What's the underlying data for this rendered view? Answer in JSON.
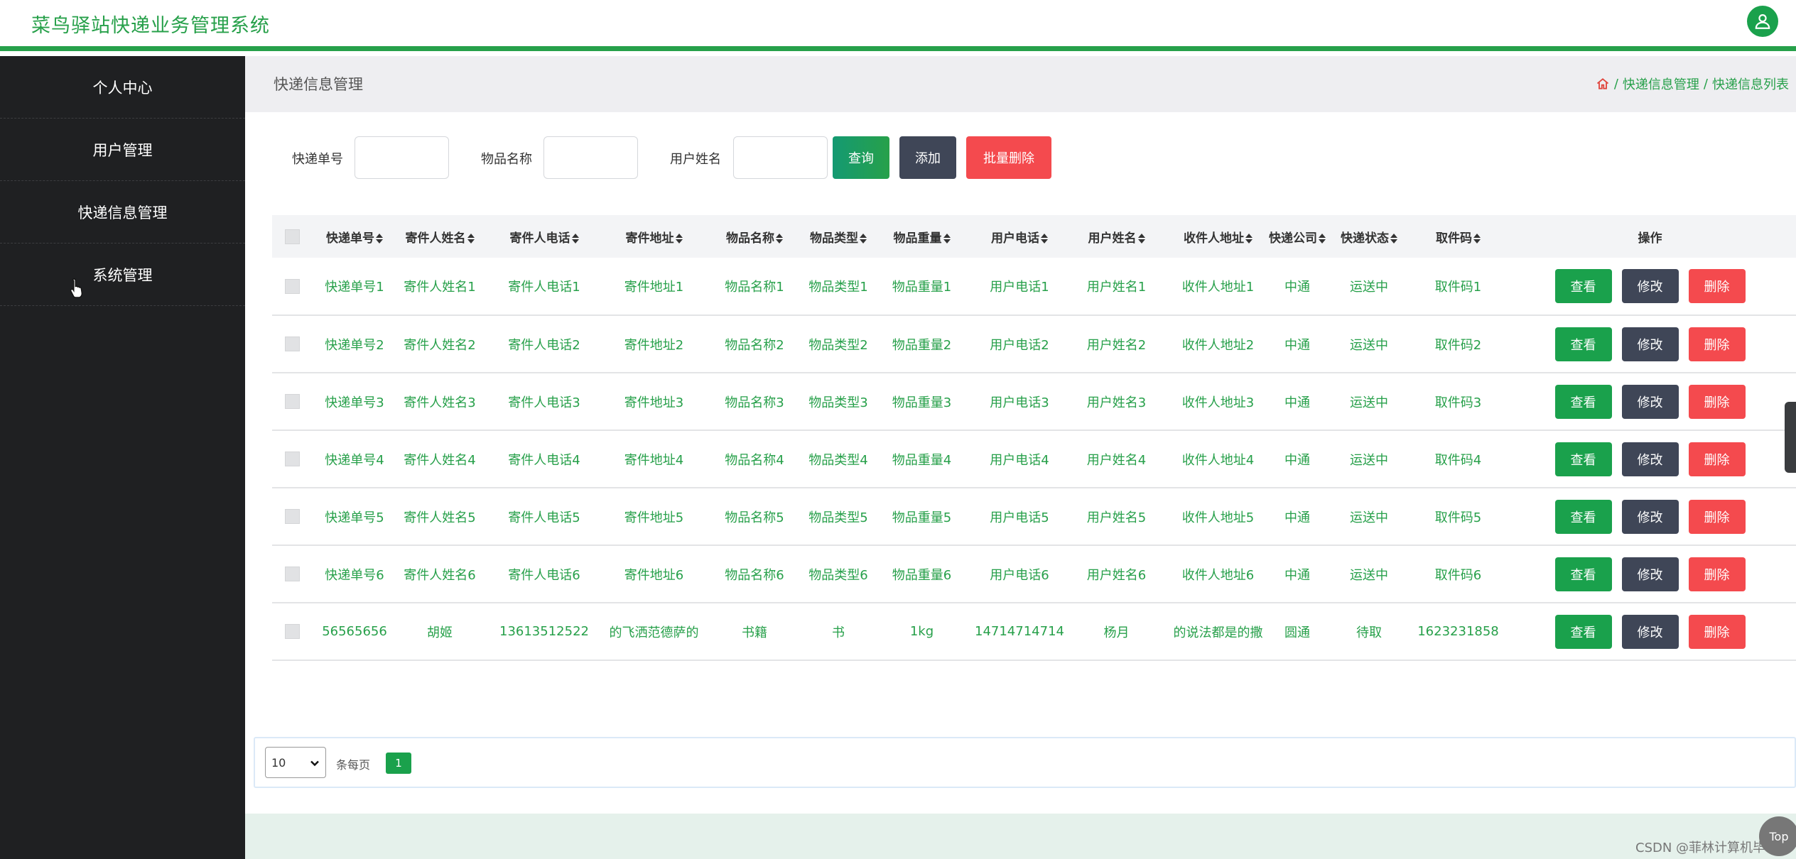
{
  "app": {
    "title": "菜鸟驿站快递业务管理系统"
  },
  "header": {
    "avatar_icon": "user-icon"
  },
  "sidebar": {
    "items": [
      {
        "label": "个人中心"
      },
      {
        "label": "用户管理"
      },
      {
        "label": "快递信息管理"
      },
      {
        "label": "系统管理"
      }
    ]
  },
  "page": {
    "heading": "快递信息管理",
    "breadcrumb": {
      "home_icon": "home-icon",
      "sep": "/",
      "level1": "快递信息管理",
      "level2": "快递信息列表"
    }
  },
  "search": {
    "tracking_label": "快递单号",
    "tracking_value": "",
    "item_name_label": "物品名称",
    "item_name_value": "",
    "user_name_label": "用户姓名",
    "user_name_value": "",
    "query_button": "查询",
    "add_button": "添加",
    "batch_delete_button": "批量删除"
  },
  "table": {
    "columns": [
      "快递单号",
      "寄件人姓名",
      "寄件人电话",
      "寄件地址",
      "物品名称",
      "物品类型",
      "物品重量",
      "用户电话",
      "用户姓名",
      "收件人地址",
      "快递公司",
      "快递状态",
      "取件码"
    ],
    "actions_header": "操作",
    "action_labels": {
      "view": "查看",
      "edit": "修改",
      "delete": "删除"
    },
    "rows": [
      [
        "快递单号1",
        "寄件人姓名1",
        "寄件人电话1",
        "寄件地址1",
        "物品名称1",
        "物品类型1",
        "物品重量1",
        "用户电话1",
        "用户姓名1",
        "收件人地址1",
        "中通",
        "运送中",
        "取件码1"
      ],
      [
        "快递单号2",
        "寄件人姓名2",
        "寄件人电话2",
        "寄件地址2",
        "物品名称2",
        "物品类型2",
        "物品重量2",
        "用户电话2",
        "用户姓名2",
        "收件人地址2",
        "中通",
        "运送中",
        "取件码2"
      ],
      [
        "快递单号3",
        "寄件人姓名3",
        "寄件人电话3",
        "寄件地址3",
        "物品名称3",
        "物品类型3",
        "物品重量3",
        "用户电话3",
        "用户姓名3",
        "收件人地址3",
        "中通",
        "运送中",
        "取件码3"
      ],
      [
        "快递单号4",
        "寄件人姓名4",
        "寄件人电话4",
        "寄件地址4",
        "物品名称4",
        "物品类型4",
        "物品重量4",
        "用户电话4",
        "用户姓名4",
        "收件人地址4",
        "中通",
        "运送中",
        "取件码4"
      ],
      [
        "快递单号5",
        "寄件人姓名5",
        "寄件人电话5",
        "寄件地址5",
        "物品名称5",
        "物品类型5",
        "物品重量5",
        "用户电话5",
        "用户姓名5",
        "收件人地址5",
        "中通",
        "运送中",
        "取件码5"
      ],
      [
        "快递单号6",
        "寄件人姓名6",
        "寄件人电话6",
        "寄件地址6",
        "物品名称6",
        "物品类型6",
        "物品重量6",
        "用户电话6",
        "用户姓名6",
        "收件人地址6",
        "中通",
        "运送中",
        "取件码6"
      ],
      [
        "56565656",
        "胡姬",
        "13613512522",
        "的飞洒范德萨的",
        "书籍",
        "书",
        "1kg",
        "14714714714",
        "杨月",
        "的说法都是的撒",
        "圆通",
        "待取",
        "1623231858"
      ]
    ]
  },
  "pagination": {
    "page_size": "10",
    "per_page_label": "条每页",
    "current_page": "1"
  },
  "watermark": "CSDN @菲林计算机毕设",
  "back_to_top": "Top",
  "colors": {
    "brand": "#27a04a",
    "sidebar": "#1f2022",
    "edit": "#3f4657",
    "danger": "#f44a4e"
  }
}
